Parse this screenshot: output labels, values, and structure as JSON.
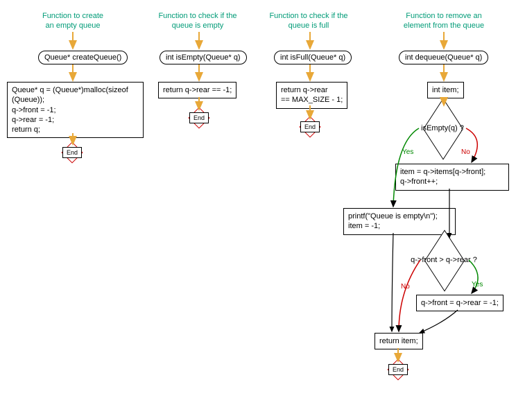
{
  "fc1": {
    "caption": "Function to create\nan empty queue",
    "head": "Queue* createQueue()",
    "body": "Queue* q = (Queue*)malloc(sizeof\n(Queue));\nq->front = -1;\nq->rear = -1;\nreturn q;",
    "end": "End"
  },
  "fc2": {
    "caption": "Function to check if the\nqueue is empty",
    "head": "int isEmpty(Queue* q)",
    "body": "return q->rear == -1;",
    "end": "End"
  },
  "fc3": {
    "caption": "Function to check if the\nqueue is full",
    "head": "int isFull(Queue* q)",
    "body": "return q->rear\n== MAX_SIZE - 1;",
    "end": "End"
  },
  "fc4": {
    "caption": "Function to remove an\nelement from the queue",
    "head": "int dequeue(Queue* q)",
    "decl": "int item;",
    "cond1": "isEmpty(q) ?",
    "yesBranch": "printf(\"Queue is empty\\n\");\nitem = -1;",
    "noBranch": "item = q->items[q->front];\nq->front++;",
    "cond2": "q->front > q->rear ?",
    "resetBox": "q->front = q->rear = -1;",
    "ret": "return item;",
    "end": "End",
    "labels": {
      "yes": "Yes",
      "no": "No"
    }
  }
}
